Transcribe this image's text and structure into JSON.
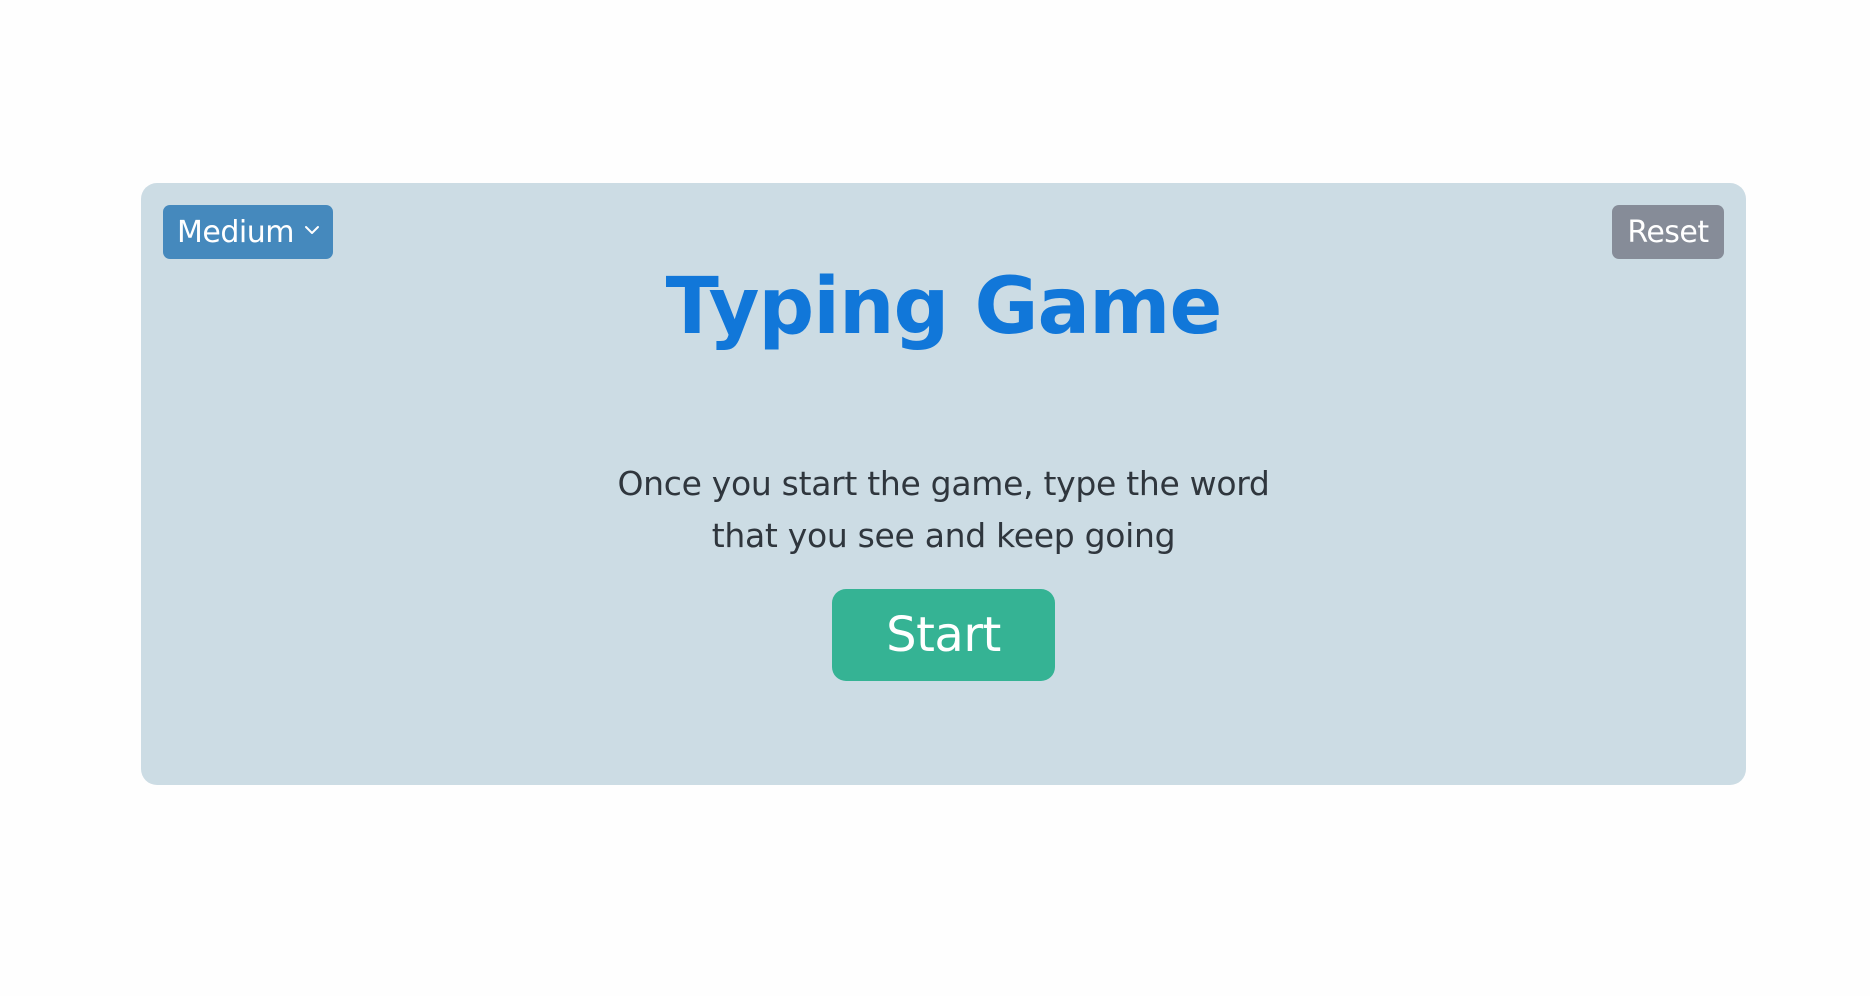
{
  "app": {
    "title": "Typing Game"
  },
  "difficulty": {
    "selected": "Medium",
    "icon": "chevron-down-icon"
  },
  "reset": {
    "label": "Reset"
  },
  "instructions": {
    "line1": "Once you start the game, type the word",
    "line2": "that you see and keep going"
  },
  "start": {
    "label": "Start"
  },
  "colors": {
    "background": "#fefefe",
    "card": "#ccdce4",
    "title": "#1177d9",
    "difficulty_button": "#4589bd",
    "reset_button": "#868c98",
    "start_button": "#35b394",
    "text": "#2f363d"
  }
}
